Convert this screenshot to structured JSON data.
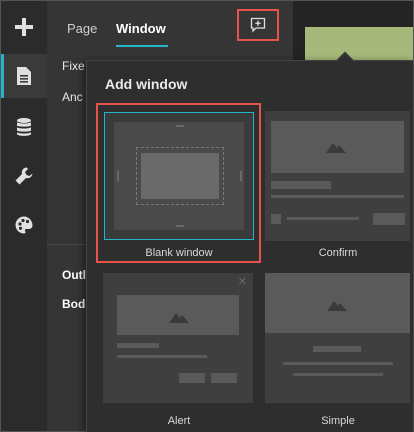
{
  "rail": {
    "items": [
      {
        "name": "add",
        "icon": "plus-icon"
      },
      {
        "name": "pages",
        "icon": "document-icon"
      },
      {
        "name": "data",
        "icon": "database-icon"
      },
      {
        "name": "tools",
        "icon": "wrench-icon"
      },
      {
        "name": "theme",
        "icon": "palette-icon"
      }
    ]
  },
  "panel": {
    "tabs": {
      "page": "Page",
      "window": "Window"
    },
    "partial_labels": {
      "fixed": "Fixe",
      "anchor": "Anc",
      "outline": "Outl",
      "body": "Bod"
    }
  },
  "popover": {
    "title": "Add window",
    "templates": [
      {
        "label": "Blank window",
        "selected": true
      },
      {
        "label": "Confirm",
        "selected": false
      },
      {
        "label": "Alert",
        "selected": false
      },
      {
        "label": "Simple",
        "selected": false
      }
    ]
  },
  "colors": {
    "accent": "#24b5c9",
    "highlight": "#e5534b",
    "panel": "#353535",
    "rail": "#2b2b2b"
  }
}
